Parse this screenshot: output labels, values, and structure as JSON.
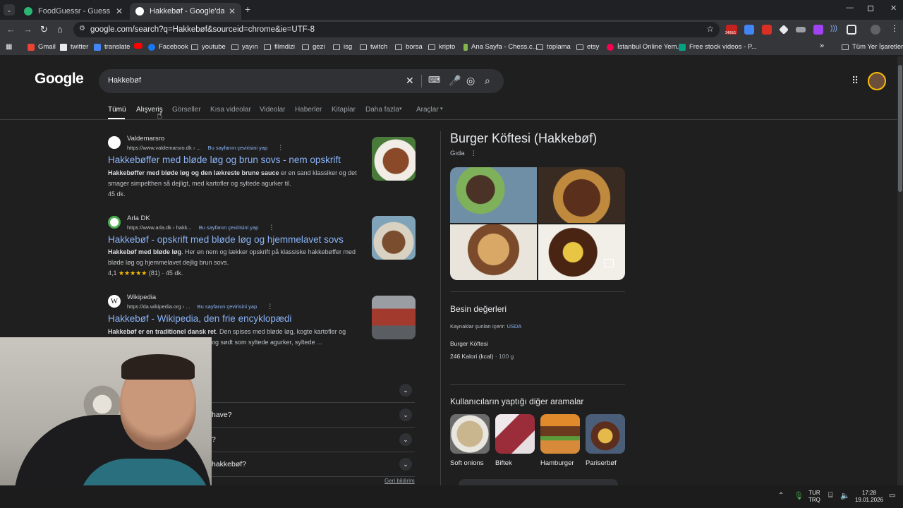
{
  "browser": {
    "tabs": [
      {
        "title": "FoodGuessr - Guess Food from",
        "active": false,
        "favicon_color": "#2bb673"
      },
      {
        "title": "Hakkebøf - Google'da Ara",
        "active": true,
        "favicon_color": "#ffffff"
      }
    ],
    "new_tab": "+",
    "url": "google.com/search?q=Hakkebøf&sourceid=chrome&ie=UTF-8",
    "badge": "2406/1",
    "bookmarks": [
      {
        "label": "Gmail",
        "icon": "gmail-icon"
      },
      {
        "label": "twitter",
        "icon": "x-icon"
      },
      {
        "label": "translate",
        "icon": "translate-icon"
      },
      {
        "label": "",
        "icon": "youtube-icon"
      },
      {
        "label": "Facebook",
        "icon": "facebook-icon"
      },
      {
        "label": "youtube",
        "icon": "folder-icon"
      },
      {
        "label": "yayın",
        "icon": "folder-icon"
      },
      {
        "label": "filmdizi",
        "icon": "folder-icon"
      },
      {
        "label": "gezi",
        "icon": "folder-icon"
      },
      {
        "label": "isg",
        "icon": "folder-icon"
      },
      {
        "label": "twitch",
        "icon": "folder-icon"
      },
      {
        "label": "borsa",
        "icon": "folder-icon"
      },
      {
        "label": "kripto",
        "icon": "folder-icon"
      },
      {
        "label": "Ana Sayfa - Chess.c...",
        "icon": "chess-icon"
      },
      {
        "label": "toplama",
        "icon": "folder-icon"
      },
      {
        "label": "etsy",
        "icon": "folder-icon"
      },
      {
        "label": "İstanbul Online Yem...",
        "icon": "yemeksepeti-icon"
      },
      {
        "label": "Free stock videos - P...",
        "icon": "pexels-icon"
      }
    ],
    "all_bookmarks": "Tüm Yer İşaretleri"
  },
  "google": {
    "logo": "Google",
    "query": "Hakkebøf",
    "tabs": [
      "Tümü",
      "Alışveriş",
      "Görseller",
      "Kısa videolar",
      "Videolar",
      "Haberler",
      "Kitaplar",
      "Daha fazla",
      "Araçlar"
    ],
    "results": [
      {
        "site": "Valdemarsro",
        "url": "https://www.valdemarsro.dk › ...",
        "translate": "Bu sayfanın çevirisini yap",
        "title": "Hakkebøffer med bløde løg og brun sovs - nem opskrift",
        "snippet_bold": "Hakkebøffer med bløde løg og den lækreste brune sauce",
        "snippet_rest": " er en sand klassiker og det smager simpelthen så dejligt, med kartofler og syltede agurker til.",
        "meta": "45 dk."
      },
      {
        "site": "Arla DK",
        "url": "https://www.arla.dk › hakk...",
        "translate": "Bu sayfanın çevirisini yap",
        "title": "Hakkebøf - opskrift med bløde løg og hjemmelavet sovs",
        "snippet_bold": "Hakkebøf med bløde løg",
        "snippet_rest": ". Her en nem og lækker opskrift på klassiske hakkebøffer med bløde løg og hjemmelavet dejlig brun sovs.",
        "rating": "4,1",
        "stars": "★★★★★",
        "reviews": "(81)",
        "meta": "· 45 dk."
      },
      {
        "site": "Wikipedia",
        "url": "https://da.wikipedia.org › ...",
        "translate": "Bu sayfanın çevirisini yap",
        "title": "Hakkebøf - Wikipedia, den frie encyklopædi",
        "snippet_bold": "Hakkebøf er en traditionel dansk ret",
        "snippet_rest": ". Den spises med bløde løg, kogte kartofler og",
        "snippet_line2": "og sødt som syltede agurker, syltede ..."
      }
    ],
    "paa": [
      "have?",
      "?",
      "hakkebøf?"
    ],
    "feedback": "Geri bildirim",
    "knowledge_panel": {
      "title": "Burger Köftesi (Hakkebøf)",
      "subtitle": "Gıda",
      "nutrition_heading": "Besin değerleri",
      "source_prefix": "Kaynaklar şunları içerir:",
      "source_link": "USDA",
      "food": "Burger Köftesi",
      "calories": "246 Kalori (kcal)",
      "portion": "· 100 g",
      "related_heading": "Kullanıcıların yaptığı diğer aramalar",
      "related": [
        "Soft onions",
        "Biftek",
        "Hamburger",
        "Pariserbøf"
      ]
    }
  },
  "taskbar": {
    "lang_top": "TUR",
    "lang_bottom": "TRQ",
    "time": "17:28",
    "date": "19.01.2026"
  }
}
